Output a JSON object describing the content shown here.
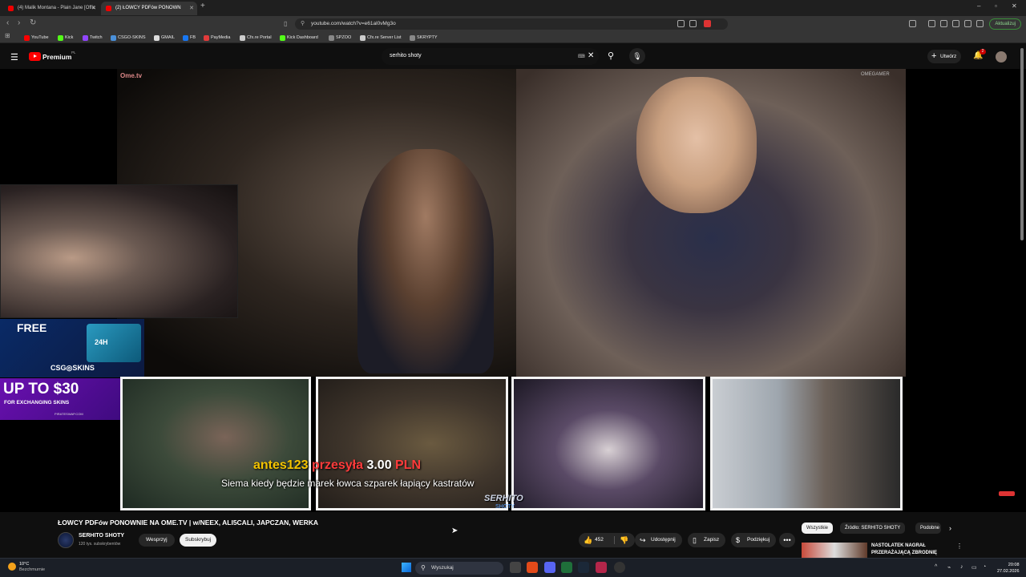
{
  "browser": {
    "tabs": [
      {
        "title": "(4) Malik Montana - Plain Jane [Offic"
      },
      {
        "title": "(2) ŁOWCY PDFów PONOWN"
      }
    ],
    "url": "youtube.com/watch?v=e61al0vMg3o",
    "update_label": "Aktualizuj",
    "bookmarks": [
      {
        "label": "YouTube",
        "color": "#ff0000"
      },
      {
        "label": "Kick",
        "color": "#53fc18"
      },
      {
        "label": "Twitch",
        "color": "#9146ff"
      },
      {
        "label": "CSGO-SKINS",
        "color": "#4a90d9"
      },
      {
        "label": "GMAIL",
        "color": "#dddddd"
      },
      {
        "label": "FB",
        "color": "#1877f2"
      },
      {
        "label": "PayMedia",
        "color": "#e23b3b"
      },
      {
        "label": "Cfx.re Portal",
        "color": "#cccccc"
      },
      {
        "label": "Kick Dashboard",
        "color": "#53fc18"
      },
      {
        "label": "SPZOO",
        "color": "#888888"
      },
      {
        "label": "Cfx.re Server List",
        "color": "#cccccc"
      },
      {
        "label": "SKRYPTY",
        "color": "#888888"
      }
    ]
  },
  "youtube": {
    "logo_text": "Premium",
    "logo_sup": "PL",
    "search_value": "serhito shoty",
    "create_label": "Utwórz",
    "notification_count": "2"
  },
  "video": {
    "overlay_brand": "Ome.tv",
    "corner_watermark": "OMEGAMER",
    "ad_free": "FREE",
    "ad_box_label": "24H",
    "ad_brand": "CSG◎SKINS",
    "ad2_big": "UP TO $30",
    "ad2_sub": "FOR EXCHANGING SKINS",
    "ad2_tiny": "PIRATESWAP.COM",
    "donor_name": "antes123",
    "donor_action": "przesyła",
    "donor_amount": "3.00",
    "donor_currency": "PLN",
    "donor_message": "Siema kiedy będzie marek łowca szparek łapiący kastratów",
    "logo_main": "SERHITO",
    "logo_sub": "SHOTY"
  },
  "info": {
    "title": "ŁOWCY PDFów PONOWNIE NA OME.TV | w/NEEX, ALI5CALI, JAPCZAN, WERKA",
    "channel": "SERHITO SHOTY",
    "subscribers": "120 tys. subskrybentów",
    "join_label": "Wesprzyj",
    "subscribe_label": "Subskrybuj",
    "likes": "452",
    "share_label": "Udostępnij",
    "save_label": "Zapisz",
    "thanks_label": "Podziękuj",
    "more_label": "•••"
  },
  "sidebar": {
    "chips": [
      "Wszystkie",
      "Źródło: SERHITO SHOTY",
      "Podobne"
    ],
    "rec_title": "NASTOLATEK NAGRAŁ PRZERAŻAJĄCĄ ZBRODNIĘ"
  },
  "taskbar": {
    "temp": "10°C",
    "condition": "Bezchmurnie",
    "search_label": "Wyszukaj",
    "time": "20:08",
    "date": "27.02.2026"
  }
}
